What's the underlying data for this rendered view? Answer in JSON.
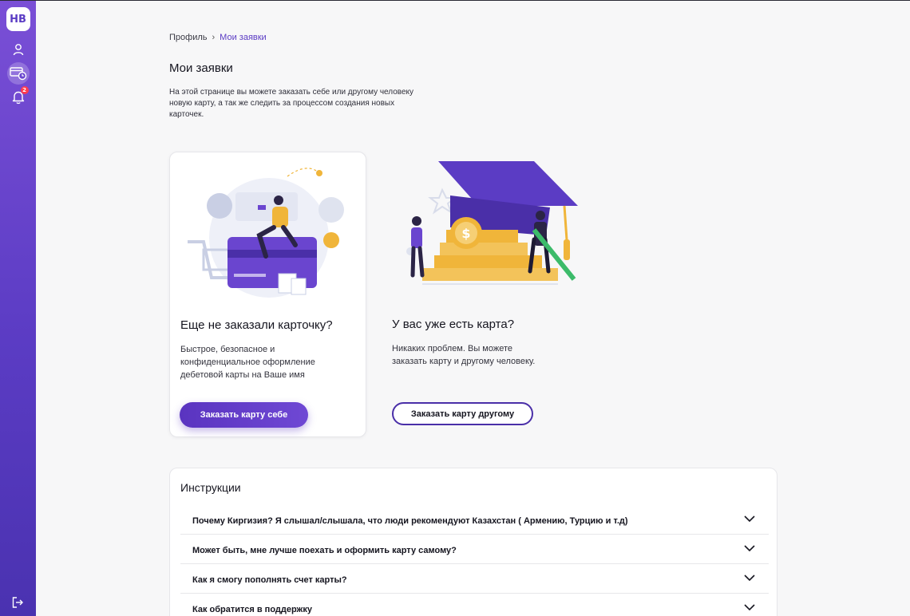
{
  "sidebar": {
    "logo": "НВ",
    "items": [
      {
        "icon": "user-icon"
      },
      {
        "icon": "card-clock-icon",
        "active": true
      },
      {
        "icon": "bell-icon",
        "badge": "2"
      }
    ],
    "logout_icon": "logout-icon"
  },
  "breadcrumb": {
    "parent": "Профиль",
    "separator": "›",
    "current": "Мои заявки"
  },
  "page": {
    "title": "Мои заявки",
    "description": "На этой странице вы можете заказать себе или другому человеку новую карту, а так же следить за процессом создания новых карточек."
  },
  "cards": {
    "self": {
      "title": "Еще не заказали карточку?",
      "text": "Быстрое, безопасное и конфиденциальное оформление дебетовой карты на Ваше имя",
      "button": "Заказать карту себе"
    },
    "other": {
      "title": "У вас уже есть карта?",
      "text": "Никаких проблем. Вы можете заказать карту и другому человеку.",
      "button": "Заказать карту другому"
    }
  },
  "instructions": {
    "title": "Инструкции",
    "items": [
      "Почему Киргизия? Я слышал/слышала, что люди рекомендуют Казахстан ( Армению, Турцию и т.д)",
      "Может быть, мне лучше поехать и оформить карту самому?",
      "Как я смогу пополнять счет карты?",
      "Как обратится в поддержку"
    ]
  },
  "colors": {
    "accent": "#5b3cc4",
    "sidebar_top": "#7a4fd6",
    "sidebar_bottom": "#4a32b0",
    "gold": "#f0b53a",
    "badge": "#ff3b4e"
  }
}
